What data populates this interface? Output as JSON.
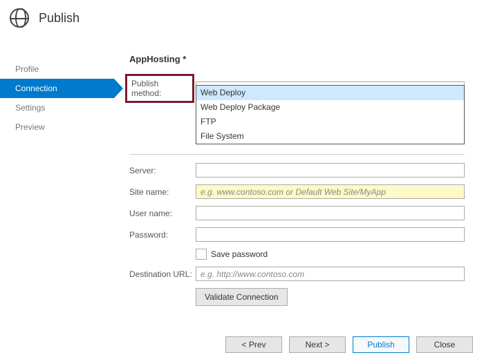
{
  "header": {
    "title": "Publish"
  },
  "sidebar": {
    "items": [
      {
        "label": "Profile"
      },
      {
        "label": "Connection"
      },
      {
        "label": "Settings"
      },
      {
        "label": "Preview"
      }
    ]
  },
  "section": {
    "heading": "AppHosting *"
  },
  "form": {
    "publish_method_label": "Publish method:",
    "publish_method_value": "Web Deploy",
    "publish_method_options": [
      "Web Deploy",
      "Web Deploy Package",
      "FTP",
      "File System"
    ],
    "server_label": "Server:",
    "server_value": "",
    "site_label": "Site name:",
    "site_value": "",
    "site_placeholder": "e.g. www.contoso.com or Default Web Site/MyApp",
    "user_label": "User name:",
    "user_value": "",
    "password_label": "Password:",
    "password_value": "",
    "save_password_label": "Save password",
    "dest_label": "Destination URL:",
    "dest_value": "",
    "dest_placeholder": "e.g. http://www.contoso.com",
    "validate_label": "Validate Connection"
  },
  "footer": {
    "prev": "< Prev",
    "next": "Next >",
    "publish": "Publish",
    "close": "Close"
  }
}
